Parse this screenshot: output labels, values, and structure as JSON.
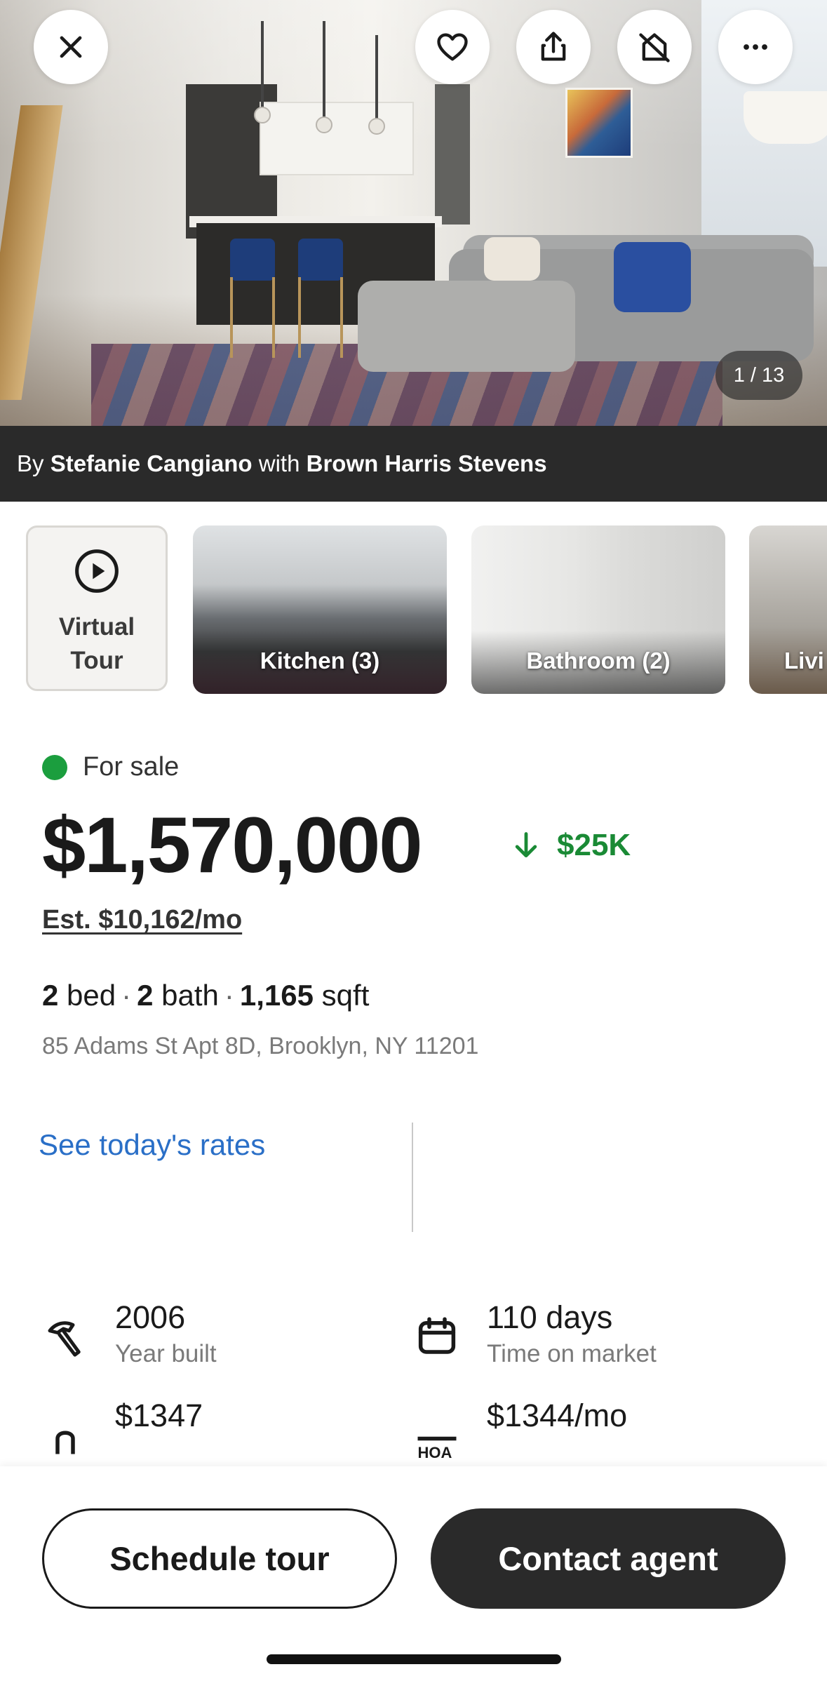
{
  "hero": {
    "photo_counter": "1 / 13",
    "attribution_prefix": "By",
    "agent_name": "Stefanie Cangiano",
    "attribution_mid": "with",
    "brokerage": "Brown Harris Stevens",
    "icons": [
      "close-icon",
      "heart-icon",
      "share-icon",
      "hide-icon",
      "more-icon"
    ]
  },
  "thumbnails": [
    {
      "label": "Virtual Tour",
      "line1": "Virtual",
      "line2": "Tour",
      "icon": "play-icon"
    },
    {
      "label": "Kitchen (3)"
    },
    {
      "label": "Bathroom (2)"
    },
    {
      "label": "Livi"
    }
  ],
  "listing": {
    "status": "For sale",
    "status_color": "#1b9e3e",
    "price": "$1,570,000",
    "price_drop": "$25K",
    "estimate": "Est. $10,162/mo",
    "beds": "2",
    "beds_label": "bed",
    "baths": "2",
    "baths_label": "bath",
    "sqft": "1,165",
    "sqft_label": "sqft",
    "address": "85 Adams St Apt 8D, Brooklyn, NY 11201",
    "rates_link": "See today's rates",
    "accent_link_color": "#2a6fc7"
  },
  "facts": [
    {
      "value": "2006",
      "label": "Year built",
      "icon": "hammer-icon"
    },
    {
      "value": "110 days",
      "label": "Time on market",
      "icon": "calendar-icon"
    },
    {
      "value": "$1347",
      "label": "",
      "icon": "tax-icon"
    },
    {
      "value": "$1344/mo",
      "label": "",
      "icon": "hoa-icon"
    }
  ],
  "actions": {
    "schedule": "Schedule tour",
    "contact": "Contact agent"
  }
}
